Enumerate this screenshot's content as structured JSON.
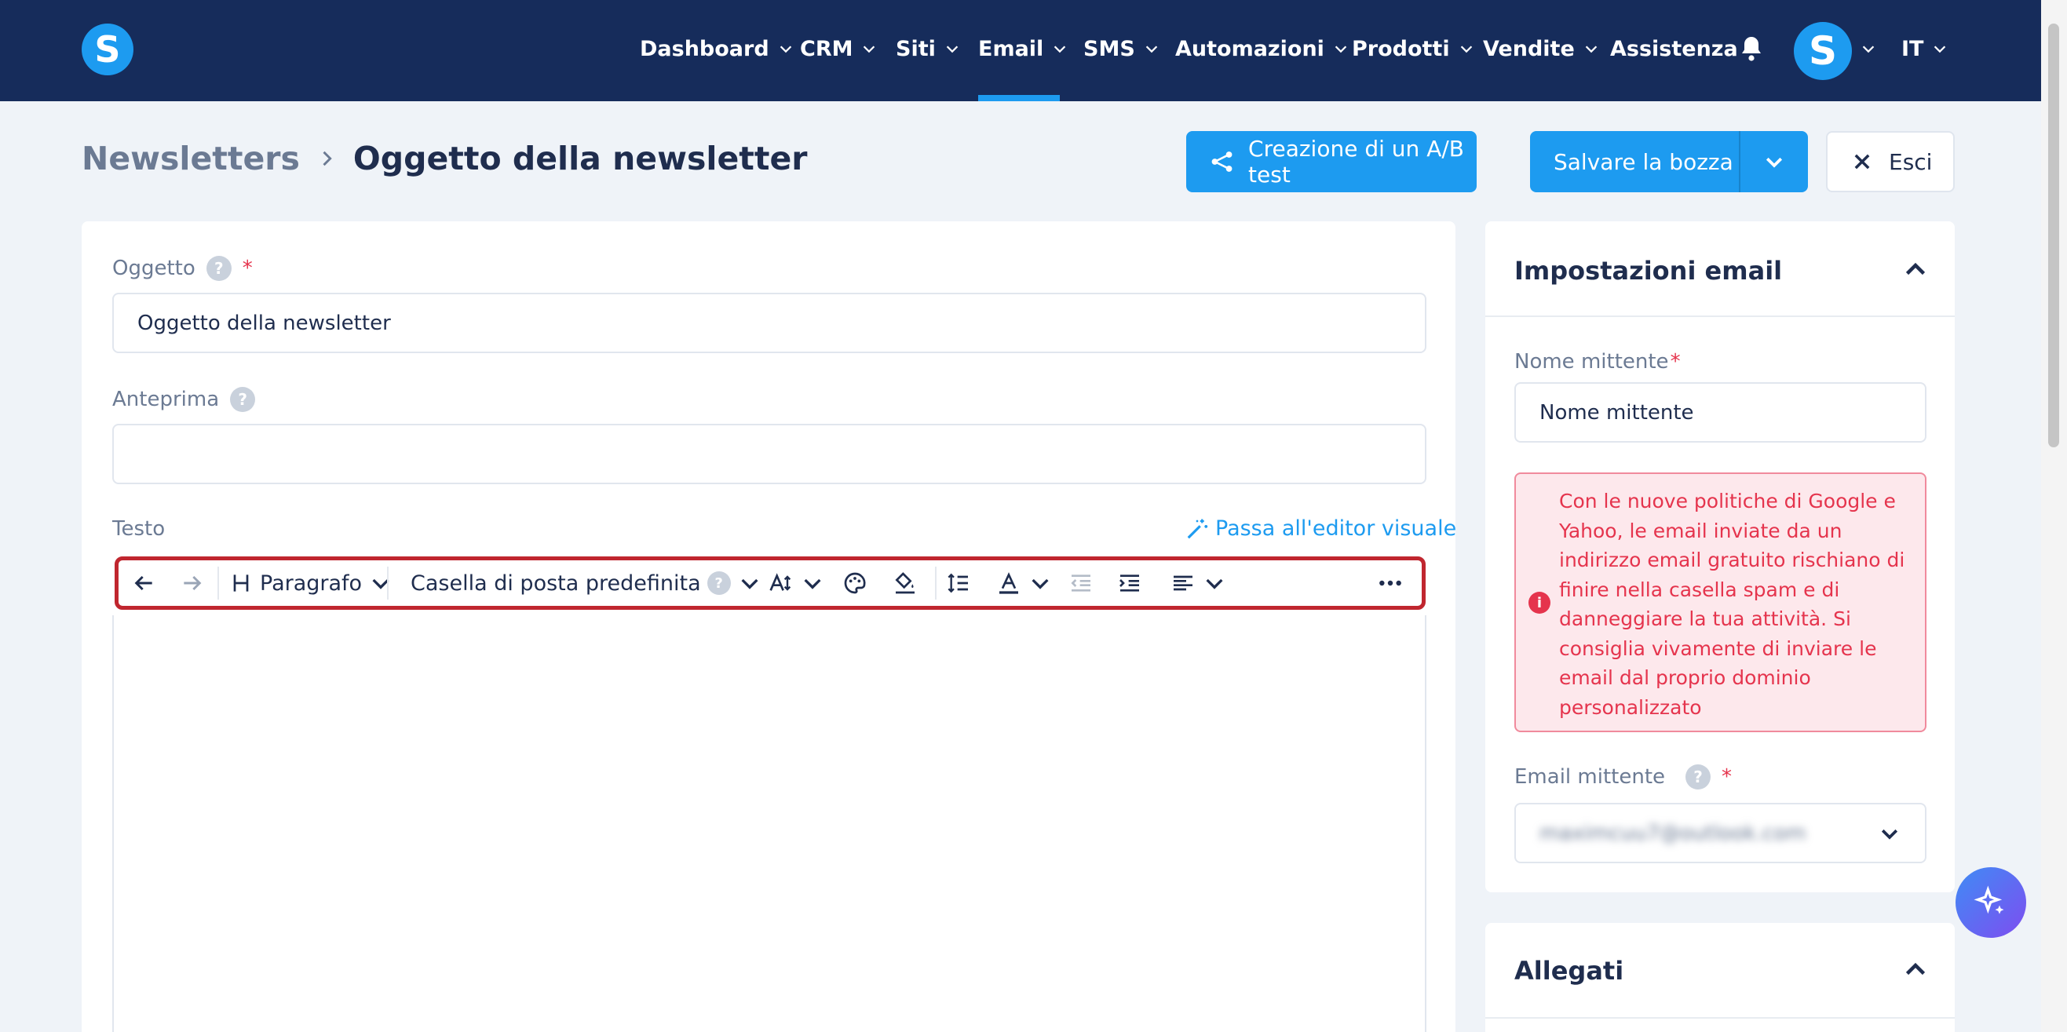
{
  "nav": {
    "items": [
      "Dashboard",
      "CRM",
      "Siti",
      "Email",
      "SMS",
      "Automazioni",
      "Prodotti",
      "Vendite",
      "Assistenza"
    ],
    "active": "Email",
    "logo_letter": "S",
    "avatar_letter": "S",
    "language": "IT"
  },
  "breadcrumb": {
    "parent": "Newsletters",
    "current": "Oggetto della newsletter"
  },
  "actions": {
    "ab_test_label": "Creazione di un A/B test",
    "save_draft_label": "Salvare la bozza",
    "exit_label": "Esci"
  },
  "form": {
    "subject_label": "Oggetto",
    "subject_value": "Oggetto della newsletter",
    "preview_label": "Anteprima",
    "preview_value": "",
    "text_label": "Testo",
    "visual_editor_link": "Passa all'editor visuale",
    "required_mark": "*",
    "help_mark": "?"
  },
  "toolbar": {
    "paragraph_label": "Paragrafo",
    "mailbox_label": "Casella di posta predefinita"
  },
  "settings": {
    "title": "Impostazioni email",
    "sender_name_label": "Nome mittente",
    "sender_name_value": "Nome mittente",
    "alert_text": "Con le nuove politiche di Google e Yahoo, le email inviate da un indirizzo email gratuito rischiano di finire nella casella spam e di danneggiare la tua attività. Si consiglia vivamente di inviare le email dal proprio dominio personalizzato",
    "sender_email_label": "Email mittente",
    "sender_email_value": "maximcuu7@outlook.com"
  },
  "attachments": {
    "title": "Allegati"
  },
  "colors": {
    "navbar": "#162c5b",
    "accent": "#1d9bf0",
    "danger": "#e5344d",
    "toolbar_highlight": "#c0262f"
  },
  "icons": {
    "undo": "arrow-left-icon",
    "redo": "arrow-right-icon",
    "heading": "heading-icon",
    "font_size": "font-size-icon",
    "text_color": "palette-icon",
    "background_color": "paint-bucket-icon",
    "line_height": "line-height-icon",
    "text_format": "text-format-icon",
    "outdent": "outdent-icon",
    "indent": "indent-icon",
    "align": "align-left-icon",
    "more": "more-dots-icon"
  }
}
